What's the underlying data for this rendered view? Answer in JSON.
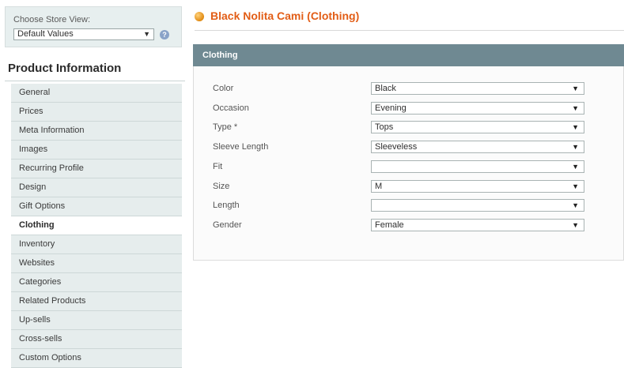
{
  "store": {
    "label": "Choose Store View:",
    "value": "Default Values"
  },
  "sidebar": {
    "title": "Product Information",
    "tabs": [
      {
        "label": "General"
      },
      {
        "label": "Prices"
      },
      {
        "label": "Meta Information"
      },
      {
        "label": "Images"
      },
      {
        "label": "Recurring Profile"
      },
      {
        "label": "Design"
      },
      {
        "label": "Gift Options"
      },
      {
        "label": "Clothing",
        "active": true
      },
      {
        "label": "Inventory"
      },
      {
        "label": "Websites"
      },
      {
        "label": "Categories"
      },
      {
        "label": "Related Products"
      },
      {
        "label": "Up-sells"
      },
      {
        "label": "Cross-sells"
      },
      {
        "label": "Custom Options"
      }
    ]
  },
  "main": {
    "title": "Black Nolita Cami (Clothing)",
    "fieldset_title": "Clothing",
    "fields": [
      {
        "label": "Color",
        "value": "Black"
      },
      {
        "label": "Occasion",
        "value": "Evening"
      },
      {
        "label": "Type *",
        "value": "Tops"
      },
      {
        "label": "Sleeve Length",
        "value": "Sleeveless"
      },
      {
        "label": "Fit",
        "value": ""
      },
      {
        "label": "Size",
        "value": "M"
      },
      {
        "label": "Length",
        "value": ""
      },
      {
        "label": "Gender",
        "value": "Female"
      }
    ]
  },
  "colors": {
    "title_orange": "#e25d16",
    "fieldset_header": "#6f8992",
    "sidebar_tab_bg": "#e6eded"
  },
  "icons": {
    "dropdown": "chevron-down-icon",
    "help": "help-icon",
    "title": "product-icon"
  }
}
